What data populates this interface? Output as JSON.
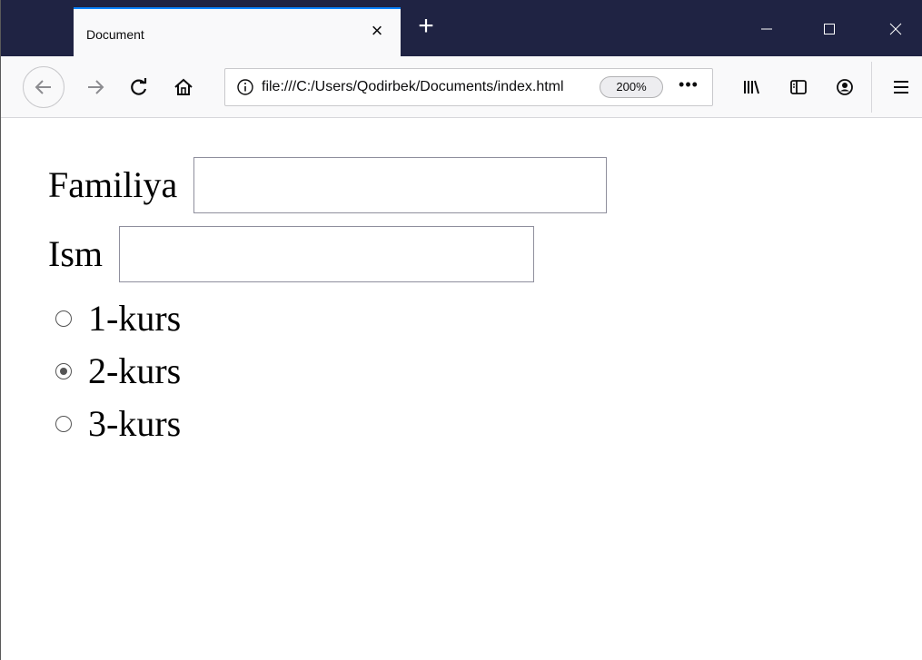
{
  "browser": {
    "tab": {
      "title": "Document",
      "close": "×"
    },
    "new_tab": "+",
    "url": "file:///C:/Users/Qodirbek/Documents/index.html",
    "zoom": "200%",
    "page_actions": "•••",
    "theme": {
      "titlebar": "#1f2343",
      "tab_accent": "#0a84ff",
      "toolbar": "#f9f9fa"
    }
  },
  "form": {
    "familiya_label": "Familiya",
    "familiya_value": "",
    "ism_label": "Ism",
    "ism_value": "",
    "courses": [
      {
        "label": "1-kurs",
        "checked": false
      },
      {
        "label": "2-kurs",
        "checked": true
      },
      {
        "label": "3-kurs",
        "checked": false
      }
    ]
  }
}
